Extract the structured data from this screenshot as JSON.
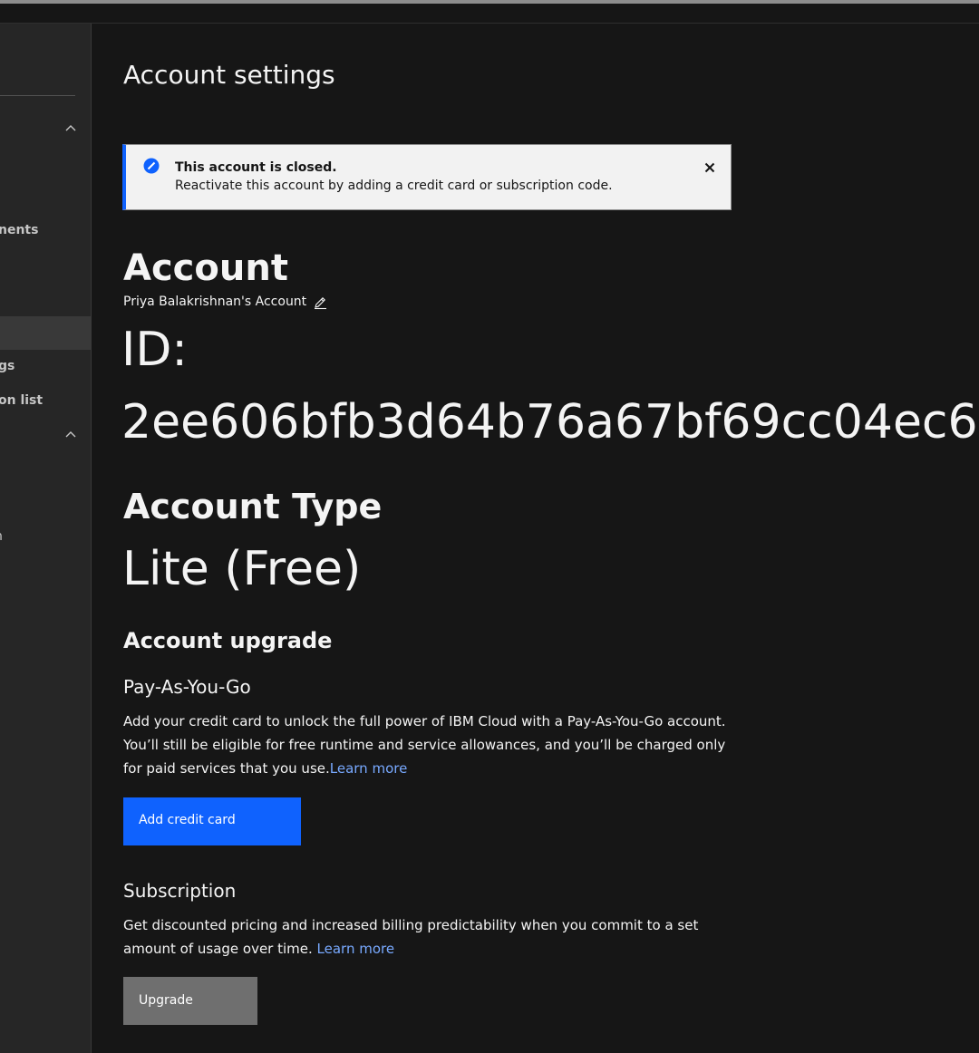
{
  "sidebar": {
    "items": [
      {
        "label": "nents"
      },
      {
        "label": "gs"
      },
      {
        "label": "on list"
      },
      {
        "label": "n"
      }
    ]
  },
  "main": {
    "page_title": "Account settings",
    "notification": {
      "title": "This account is closed.",
      "subtitle": "Reactivate this account by adding a credit card or subscription code."
    },
    "account": {
      "heading": "Account",
      "name": "Priya Balakrishnan's Account",
      "id_label": "ID:",
      "id_value": "2ee606bfb3d64b76a67bf69cc04ec6"
    },
    "account_type": {
      "heading": "Account Type",
      "value": "Lite (Free)"
    },
    "upgrade": {
      "heading": "Account upgrade",
      "payg": {
        "heading": "Pay-As-You-Go",
        "text": "Add your credit card to unlock the full power of IBM Cloud with a Pay-As-You-Go account. You’ll still be eligible for free runtime and service allowances, and you’ll be charged only for paid services that you use.",
        "link": "Learn more",
        "button": "Add credit card"
      },
      "subscription": {
        "heading": "Subscription",
        "text": "Get discounted pricing and increased billing predictability when you commit to a set amount of usage over time. ",
        "link": "Learn more",
        "button": "Upgrade"
      }
    }
  },
  "colors": {
    "background": "#161616",
    "sidebar": "#262626",
    "primary": "#0f62fe",
    "link": "#78a9ff",
    "secondary_button": "#6f6f6f"
  }
}
